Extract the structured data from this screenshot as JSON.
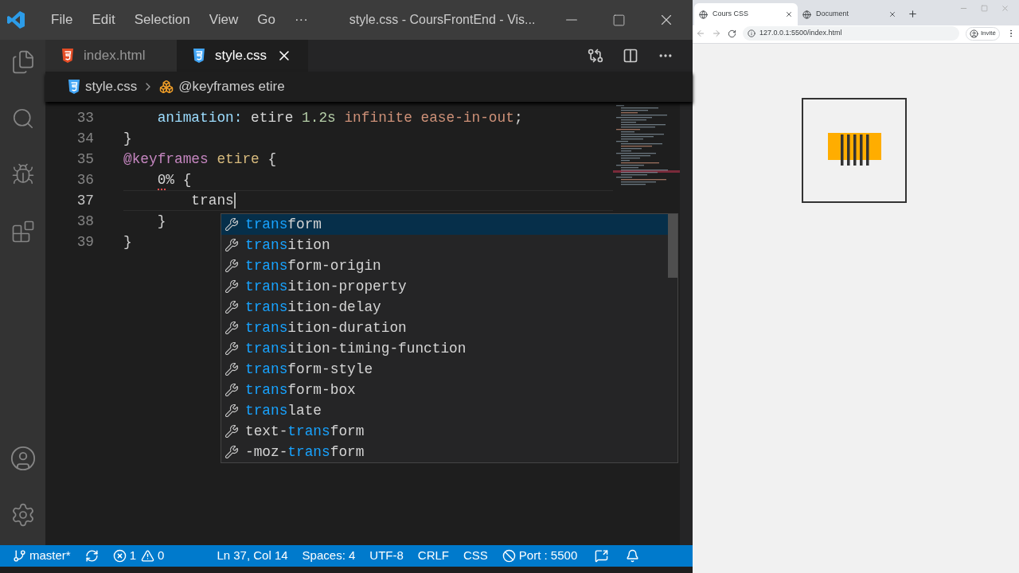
{
  "window": {
    "title": "style.css - CoursFrontEnd - Vis..."
  },
  "menu": [
    "File",
    "Edit",
    "Selection",
    "View",
    "Go",
    "···"
  ],
  "editor_tabs": [
    {
      "label": "index.html",
      "kind": "html",
      "selected": false
    },
    {
      "label": "style.css",
      "kind": "css",
      "selected": true
    }
  ],
  "breadcrumb": [
    {
      "label": "style.css",
      "kind": "css"
    },
    {
      "label": "@keyframes etire",
      "kind": "symbol"
    }
  ],
  "code_lines": [
    {
      "number": "33",
      "cursor": false,
      "error": false,
      "tokens": [
        {
          "text": "    animation: ",
          "kind": "property"
        },
        {
          "text": "etire ",
          "kind": "plain"
        },
        {
          "text": "1.2s ",
          "kind": "number"
        },
        {
          "text": "infinite ease-in-out",
          "kind": "string"
        },
        {
          "text": ";",
          "kind": "plain"
        }
      ]
    },
    {
      "number": "34",
      "cursor": false,
      "error": false,
      "tokens": [
        {
          "text": "}",
          "kind": "plain"
        }
      ]
    },
    {
      "number": "35",
      "cursor": false,
      "error": false,
      "tokens": [
        {
          "text": "@keyframes",
          "kind": "keyword"
        },
        {
          "text": " etire ",
          "kind": "name"
        },
        {
          "text": "{",
          "kind": "plain"
        }
      ]
    },
    {
      "number": "36",
      "cursor": false,
      "error": true,
      "tokens": [
        {
          "text": "    0%",
          "kind": "plain"
        },
        {
          "text": " {",
          "kind": "plain"
        }
      ]
    },
    {
      "number": "37",
      "cursor": true,
      "error": false,
      "tokens": [
        {
          "text": "        trans",
          "kind": "plain"
        }
      ]
    },
    {
      "number": "38",
      "cursor": false,
      "error": false,
      "tokens": [
        {
          "text": "    }",
          "kind": "plain"
        }
      ]
    },
    {
      "number": "39",
      "cursor": false,
      "error": false,
      "tokens": [
        {
          "text": "}",
          "kind": "plain"
        }
      ]
    }
  ],
  "suggestions": [
    {
      "match": "trans",
      "after": "form",
      "selected": true
    },
    {
      "match": "trans",
      "after": "ition",
      "selected": false
    },
    {
      "match": "trans",
      "after": "form-origin",
      "selected": false
    },
    {
      "match": "trans",
      "after": "ition-property",
      "selected": false
    },
    {
      "match": "trans",
      "after": "ition-delay",
      "selected": false
    },
    {
      "match": "trans",
      "after": "ition-duration",
      "selected": false
    },
    {
      "match": "trans",
      "after": "ition-timing-function",
      "selected": false
    },
    {
      "match": "trans",
      "after": "form-style",
      "selected": false
    },
    {
      "match": "trans",
      "after": "form-box",
      "selected": false
    },
    {
      "match": "trans",
      "after": "late",
      "selected": false
    },
    {
      "before": "text-",
      "match": "trans",
      "after": "form",
      "selected": false
    },
    {
      "before": "-moz-",
      "match": "trans",
      "after": "form",
      "selected": false
    }
  ],
  "status_bar": {
    "branch": "master*",
    "errors": "1",
    "warnings": "0",
    "items": [
      "Ln 37, Col 14",
      "Spaces: 4",
      "UTF-8",
      "CRLF",
      "CSS"
    ],
    "port": "Port : 5500"
  },
  "browser": {
    "tabs": [
      {
        "title": "Cours CSS",
        "selected": true
      },
      {
        "title": "Document",
        "selected": false
      }
    ],
    "url": "127.0.0.1:5500/index.html",
    "profile": "Invité"
  }
}
